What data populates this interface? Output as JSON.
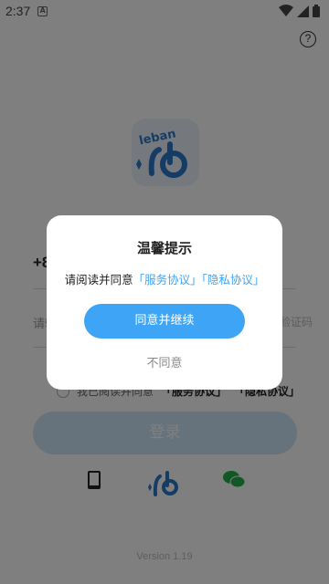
{
  "status_bar": {
    "time": "2:37",
    "notification_letter": "A"
  },
  "help_glyph": "?",
  "login": {
    "country_code": "+86",
    "phone_placeholder": "请输入手机号",
    "code_placeholder": "获取验证码",
    "agree_prefix": "我已阅读并同意",
    "agree_service": "「服务协议」",
    "agree_privacy": "「隐私协议」",
    "login_button": "登录"
  },
  "alt_login": {
    "icons": [
      "phone-icon",
      "leban-logo-icon",
      "wechat-icon"
    ]
  },
  "version": "Version 1.19",
  "logo_text": "leban",
  "dialog": {
    "title": "温馨提示",
    "message_prefix": "请阅读并同意",
    "service_link": "「服务协议」",
    "privacy_link": "「隐私协议」",
    "confirm_button": "同意并继续",
    "decline_button": "不同意"
  },
  "colors": {
    "accent": "#3ea4f5",
    "overlay": "rgba(0,0,0,0.5)",
    "login_button_bg": "#cfe6f9"
  }
}
